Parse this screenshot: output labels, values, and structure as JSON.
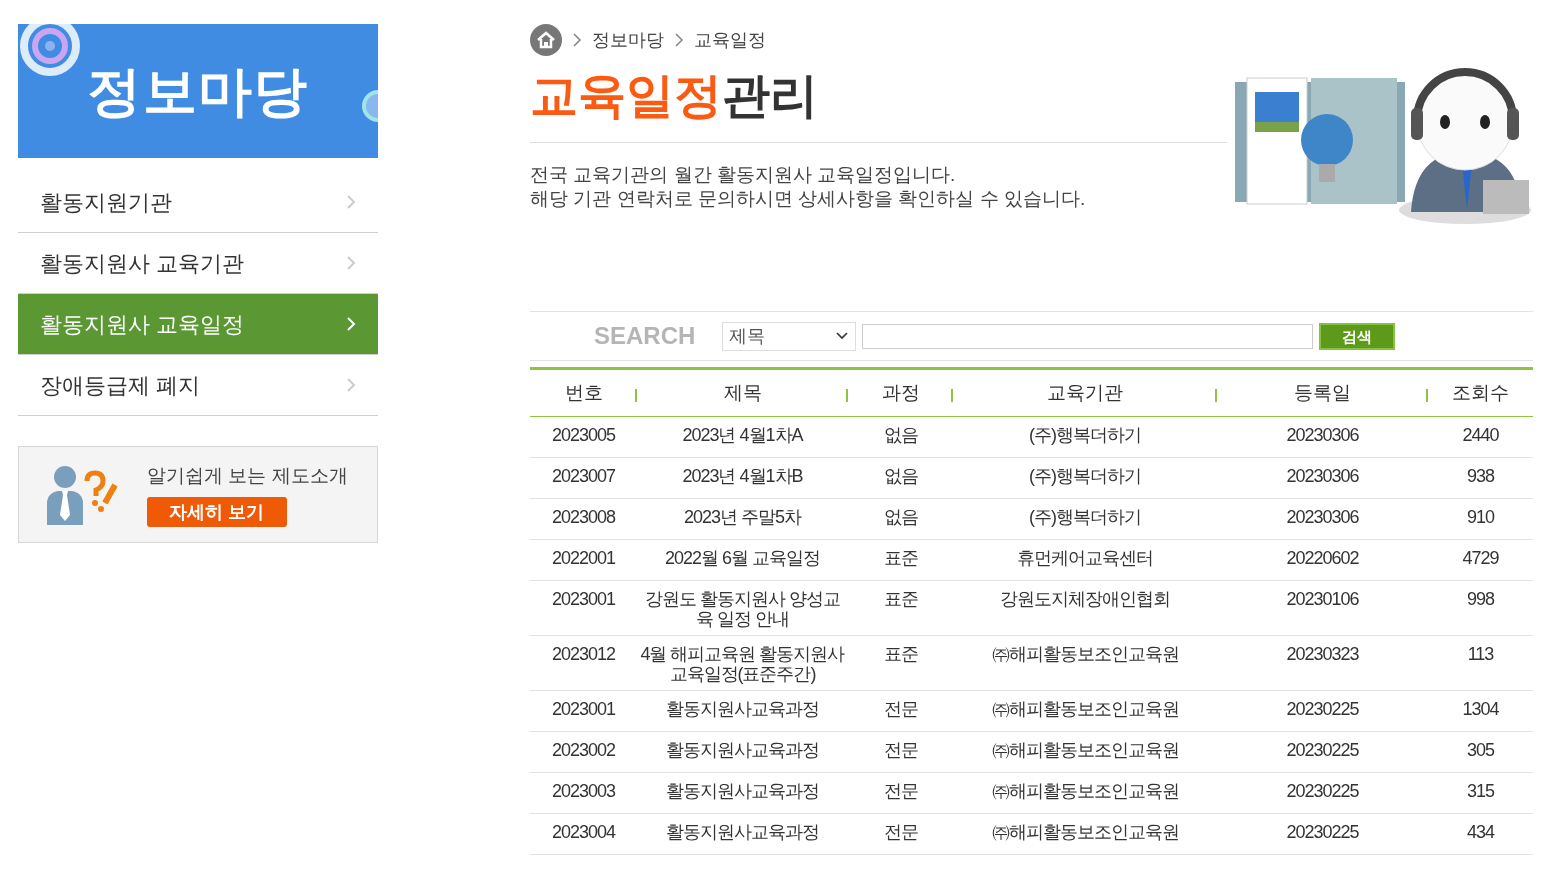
{
  "sidebar": {
    "banner_title": "정보마당",
    "items": [
      {
        "label": "활동지원기관",
        "selected": false
      },
      {
        "label": "활동지원사 교육기관",
        "selected": false
      },
      {
        "label": "활동지원사 교육일정",
        "selected": true
      },
      {
        "label": "장애등급제 폐지",
        "selected": false
      }
    ],
    "promo": {
      "text": "알기쉽게 보는 제도소개",
      "button": "자세히 보기"
    }
  },
  "breadcrumb": [
    "정보마당",
    "교육일정"
  ],
  "title": {
    "accent": "교육일정",
    "rest": "관리"
  },
  "description": [
    "전국 교육기관의 월간 활동지원사 교육일정입니다.",
    "해당 기관 연락처로 문의하시면 상세사항을 확인하실 수 있습니다."
  ],
  "search": {
    "label": "SEARCH",
    "select_value": "제목",
    "button": "검색"
  },
  "table": {
    "columns": [
      "번호",
      "제목",
      "과정",
      "교육기관",
      "등록일",
      "조회수"
    ],
    "rows": [
      [
        "2023005",
        "2023년 4월1차A",
        "없음",
        "(주)행복더하기",
        "20230306",
        "2440"
      ],
      [
        "2023007",
        "2023년 4월1차B",
        "없음",
        "(주)행복더하기",
        "20230306",
        "938"
      ],
      [
        "2023008",
        "2023년 주말5차",
        "없음",
        "(주)행복더하기",
        "20230306",
        "910"
      ],
      [
        "2022001",
        "2022월 6월 교육일정",
        "표준",
        "휴먼케어교육센터",
        "20220602",
        "4729"
      ],
      [
        "2023001",
        "강원도 활동지원사 양성교육 일정 안내",
        "표준",
        "강원도지체장애인협회",
        "20230106",
        "998"
      ],
      [
        "2023012",
        "4월 해피교육원 활동지원사교육일정(표준주간)",
        "표준",
        "㈜해피활동보조인교육원",
        "20230323",
        "113"
      ],
      [
        "2023001",
        "활동지원사교육과정",
        "전문",
        "㈜해피활동보조인교육원",
        "20230225",
        "1304"
      ],
      [
        "2023002",
        "활동지원사교육과정",
        "전문",
        "㈜해피활동보조인교육원",
        "20230225",
        "305"
      ],
      [
        "2023003",
        "활동지원사교육과정",
        "전문",
        "㈜해피활동보조인교육원",
        "20230225",
        "315"
      ],
      [
        "2023004",
        "활동지원사교육과정",
        "전문",
        "㈜해피활동보조인교육원",
        "20230225",
        "434"
      ]
    ]
  }
}
